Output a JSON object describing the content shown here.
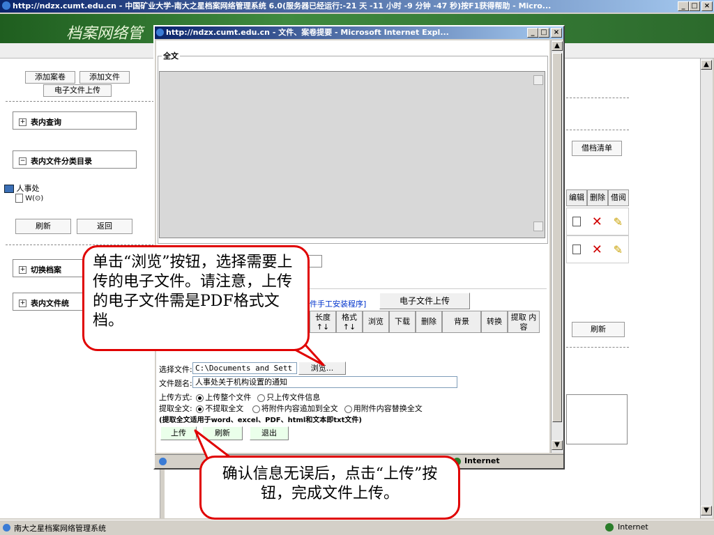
{
  "main_window": {
    "title": "http://ndzx.cumt.edu.cn - 中国矿业大学-南大之星档案网络管理系统 6.0(服务器已经运行:-21 天 -11 小时 -9 分钟 -47 秒)按F1获得帮助 - Micro...",
    "header_title": "档案网络管",
    "left": {
      "btn_add_case": "添加案卷",
      "btn_add_file": "添加文件",
      "btn_upload": "电子文件上传",
      "section_query": "表内查询",
      "section_catalog": "表内文件分类目录",
      "tree_root": "人事处",
      "tree_child": "W(⊙)",
      "btn_refresh": "刷新",
      "btn_back": "返回",
      "section_switch": "切换档案",
      "section_files": "表内文件统"
    },
    "right": {
      "btn_borrow_list": "借档清单",
      "col_edit": "编辑",
      "col_delete": "删除",
      "col_borrow": "借阅",
      "btn_refresh": "刷新"
    },
    "statusbar": {
      "text": "南大之星档案网络管理系统",
      "zone": "Internet"
    }
  },
  "popup": {
    "title": "http://ndzx.cumt.edu.cn - 文件、案卷提要 - Microsoft Internet Expl...",
    "fulltext_legend": "全文",
    "install_link": "件手工安装程序]",
    "btn_upload_file": "电子文件上传",
    "table_headers": [
      "长度 ↑↓",
      "格式 ↑↓",
      "浏览",
      "下载",
      "删除",
      "背景",
      "转换",
      "提取 内容"
    ],
    "select_file_label": "选择文件:",
    "select_file_value": "C:\\Documents and Sett",
    "browse_button": "浏览...",
    "filename_label": "文件题名:",
    "filename_value": "人事处关于机构设置的通知",
    "upload_mode_label": "上传方式:",
    "upload_mode_options": [
      "上传整个文件",
      "只上传文件信息"
    ],
    "extract_label": "提取全文:",
    "extract_options": [
      "不提取全文",
      "将附件内容追加到全文",
      "用附件内容替换全文"
    ],
    "note": "(提取全文适用于word、excel、PDF、html和文本即txt文件)",
    "btn_upload": "上传",
    "btn_refresh": "刷新",
    "btn_exit": "退出",
    "status_zone": "Internet"
  },
  "callouts": {
    "browse_tip": "单击“浏览”按钮，选择需要上传的电子文件。请注意，上传的电子文件需是PDF格式文档。",
    "upload_tip": "确认信息无误后，点击“上传”按钮，完成文件上传。"
  },
  "colors": {
    "titlebar": "#0a246a",
    "header_green": "#2c6a2c",
    "callout_border": "#e00000",
    "delete_red": "#d00000"
  }
}
